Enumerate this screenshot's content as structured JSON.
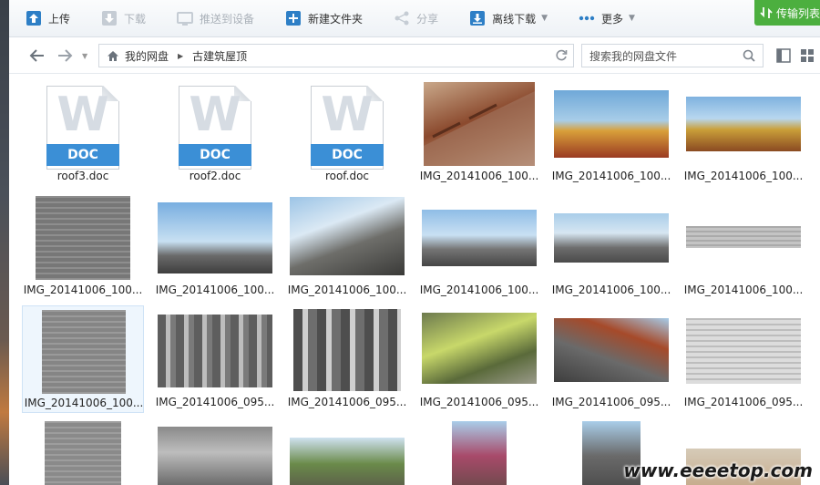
{
  "toolbar": {
    "upload": "上传",
    "download": "下载",
    "push_device": "推送到设备",
    "new_folder": "新建文件夹",
    "share": "分享",
    "offline_download": "离线下载",
    "more": "更多",
    "transfer_list": "传输列表"
  },
  "address": {
    "root": "我的网盘",
    "current": "古建筑屋顶",
    "search_placeholder": "搜索我的网盘文件"
  },
  "files": [
    {
      "name": "roof3.doc",
      "kind": "doc",
      "tag": "DOC"
    },
    {
      "name": "roof2.doc",
      "kind": "doc",
      "tag": "DOC"
    },
    {
      "name": "roof.doc",
      "kind": "doc",
      "tag": "DOC"
    },
    {
      "name": "IMG_20141006_100...",
      "kind": "image"
    },
    {
      "name": "IMG_20141006_100...",
      "kind": "image"
    },
    {
      "name": "IMG_20141006_100...",
      "kind": "image"
    },
    {
      "name": "IMG_20141006_100...",
      "kind": "image"
    },
    {
      "name": "IMG_20141006_100...",
      "kind": "image"
    },
    {
      "name": "IMG_20141006_100...",
      "kind": "image"
    },
    {
      "name": "IMG_20141006_100...",
      "kind": "image"
    },
    {
      "name": "IMG_20141006_100...",
      "kind": "image"
    },
    {
      "name": "IMG_20141006_100...",
      "kind": "image"
    },
    {
      "name": "IMG_20141006_100...",
      "kind": "image",
      "selected": true
    },
    {
      "name": "IMG_20141006_095...",
      "kind": "image"
    },
    {
      "name": "IMG_20141006_095...",
      "kind": "image"
    },
    {
      "name": "IMG_20141006_095...",
      "kind": "image"
    },
    {
      "name": "IMG_20141006_095...",
      "kind": "image"
    },
    {
      "name": "IMG_20141006_095...",
      "kind": "image"
    }
  ],
  "watermark": "www.eeeetop.com",
  "colors": {
    "accent_blue": "#3b8fd6",
    "transfer_green": "#4caf3f",
    "selection": "#eef6fd"
  },
  "icons": [
    "upload-icon",
    "download-icon",
    "push-device-icon",
    "new-folder-icon",
    "share-icon",
    "offline-download-icon",
    "more-icon",
    "home-icon",
    "refresh-icon",
    "search-icon",
    "back-icon",
    "forward-icon",
    "list-view-icon",
    "grid-view-icon"
  ]
}
